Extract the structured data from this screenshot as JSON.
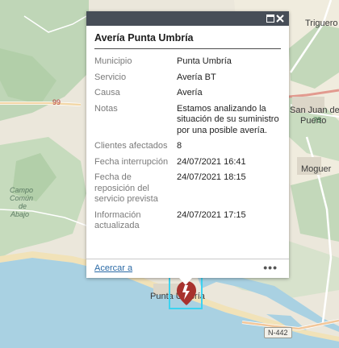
{
  "map": {
    "labels": {
      "trigueros": "Triguero",
      "san_juan_1": "San Juan del",
      "san_juan_2": "Puerto",
      "moguer": "Moguer",
      "campo_1": "Campo",
      "campo_2": "Común",
      "campo_3": "de",
      "campo_4": "Abajo",
      "punta_umbria": "Punta Umbría"
    },
    "road_shields": {
      "r99": "99",
      "r75": "75",
      "rn442": "N-442"
    }
  },
  "popup": {
    "title": "Avería Punta Umbría",
    "attributes": [
      {
        "key": "Municipio",
        "value": "Punta Umbría"
      },
      {
        "key": "Servicio",
        "value": "Avería BT"
      },
      {
        "key": "Causa",
        "value": "Avería"
      },
      {
        "key": "Notas",
        "value": "Estamos analizando la situación de su suministro por una posible avería."
      },
      {
        "key": "Clientes afectados",
        "value": "8"
      },
      {
        "key": "Fecha interrupción",
        "value": "24/07/2021 16:41"
      },
      {
        "key": "Fecha de reposición del servicio prevista",
        "value": "24/07/2021 18:15"
      },
      {
        "key": "Información actualizada",
        "value": "24/07/2021 17:15"
      }
    ],
    "footer": {
      "zoom_link": "Acercar a",
      "more": "•••"
    }
  },
  "colors": {
    "header": "#474e58",
    "marker": "#a8322d",
    "selection": "#3cd3f0",
    "link": "#2a6aa6"
  },
  "icons": {
    "marker": "outage-marker-icon",
    "maximize": "maximize-icon",
    "close": "close-icon"
  }
}
